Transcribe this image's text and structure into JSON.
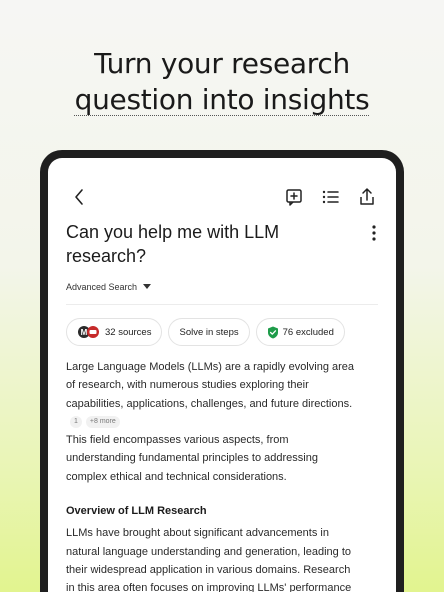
{
  "promo": {
    "line1": "Turn your research",
    "line2": "question into insights"
  },
  "header": {
    "title": "Can you help me with LLM research?",
    "advanced_search": "Advanced Search"
  },
  "chips": {
    "sources": "32 sources",
    "steps": "Solve in steps",
    "excluded": "76 excluded"
  },
  "content": {
    "p1": "Large Language Models (LLMs) are a rapidly evolving area of research, with numerous studies exploring their capabilities, applications, challenges, and future directions.",
    "cite_num": "1",
    "cite_more": "+8 more",
    "p2": "This field encompasses various aspects, from understanding fundamental principles to addressing complex ethical and technical considerations.",
    "section_title": "Overview of LLM Research",
    "p3": "LLMs have brought about significant advancements in natural language understanding and generation, leading to their widespread application in various domains. Research in this area often focuses on improving LLMs' performance"
  },
  "colors": {
    "accent_green": "#1e9c4a",
    "logo_red": "#c62a2a",
    "logo_dark": "#2b2b2b"
  }
}
